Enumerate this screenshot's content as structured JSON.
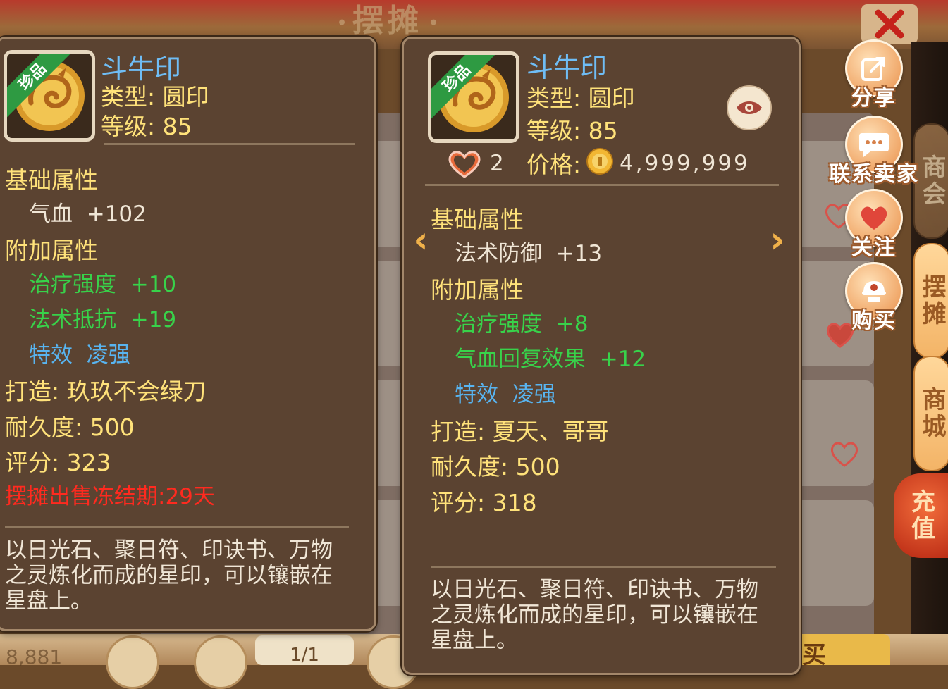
{
  "window": {
    "title": "摆摊",
    "close_icon": "close-x-icon"
  },
  "background": {
    "bottom_left_number": "8,881",
    "page_indicator": "1/1",
    "buy_button_partial": "买"
  },
  "side_tabs": [
    {
      "label": "商会",
      "state": "normal"
    },
    {
      "label": "摆摊",
      "state": "active"
    },
    {
      "label": "商城",
      "state": "normal"
    }
  ],
  "recharge": {
    "label": "充值"
  },
  "actions": {
    "share": {
      "label": "分享",
      "icon": "share-icon"
    },
    "contact": {
      "label": "联系卖家",
      "icon": "chat-bubble-icon"
    },
    "follow": {
      "label": "关注",
      "icon": "heart-icon"
    },
    "buy": {
      "label": "购买",
      "icon": "buy-icon"
    }
  },
  "left_item": {
    "badge": "珍品",
    "name": "斗牛印",
    "type": "类型: 圆印",
    "level": "等级: 85",
    "base_header": "基础属性",
    "base_attrs": [
      {
        "name": "气血",
        "value": "+102"
      }
    ],
    "extra_header": "附加属性",
    "extra_attrs": [
      {
        "name": "治疗强度",
        "value": "+10",
        "color": "green"
      },
      {
        "name": "法术抵抗",
        "value": "+19",
        "color": "green"
      },
      {
        "name": "特效",
        "value": "凌强",
        "color": "blue"
      }
    ],
    "crafter": "打造: 玖玖不会绿刀",
    "durability": "耐久度: 500",
    "score": "评分: 323",
    "freeze": "摆摊出售冻结期:29天",
    "description": "以日光石、聚日符、印诀书、万物之灵炼化而成的星印，可以镶嵌在星盘上。"
  },
  "right_item": {
    "badge": "珍品",
    "name": "斗牛印",
    "type": "类型: 圆印",
    "level": "等级: 85",
    "likes": "2",
    "price_label": "价格:",
    "price_value": "4,999,999",
    "base_header": "基础属性",
    "base_attrs": [
      {
        "name": "法术防御",
        "value": "+13"
      }
    ],
    "extra_header": "附加属性",
    "extra_attrs": [
      {
        "name": "治疗强度",
        "value": "+8",
        "color": "green"
      },
      {
        "name": "气血回复效果",
        "value": "+12",
        "color": "green"
      },
      {
        "name": "特效",
        "value": "凌强",
        "color": "blue"
      }
    ],
    "crafter": "打造: 夏天、哥哥",
    "durability": "耐久度: 500",
    "score": "评分: 318",
    "description": "以日光石、聚日符、印诀书、万物之灵炼化而成的星印，可以镶嵌在星盘上。"
  },
  "colors": {
    "name": "#6fbdf5",
    "yellow_text": "#ffe27a",
    "green_attr": "#38d24a",
    "blue_attr": "#58b4f0",
    "warning": "#ff2a1f",
    "card_bg": "#5b4331"
  }
}
